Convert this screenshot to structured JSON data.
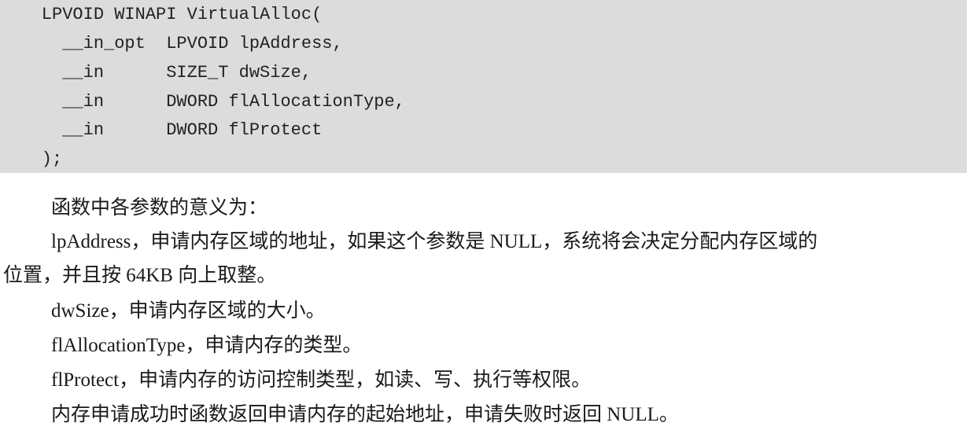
{
  "code": {
    "lines": [
      "    LPVOID WINAPI VirtualAlloc(",
      "      __in_opt  LPVOID lpAddress,",
      "      __in      SIZE_T dwSize,",
      "      __in      DWORD flAllocationType,",
      "      __in      DWORD flProtect",
      "    );"
    ]
  },
  "text": {
    "intro": "函数中各参数的意义为：",
    "lpaddress_line1": "lpAddress，申请内存区域的地址，如果这个参数是 NULL，系统将会决定分配内存区域的",
    "lpaddress_line2": "位置，并且按 64KB 向上取整。",
    "dwsize": "dwSize，申请内存区域的大小。",
    "flallocationtype": "flAllocationType，申请内存的类型。",
    "flprotect": "flProtect，申请内存的访问控制类型，如读、写、执行等权限。",
    "result": "内存申请成功时函数返回申请内存的起始地址，申请失败时返回 NULL。"
  }
}
